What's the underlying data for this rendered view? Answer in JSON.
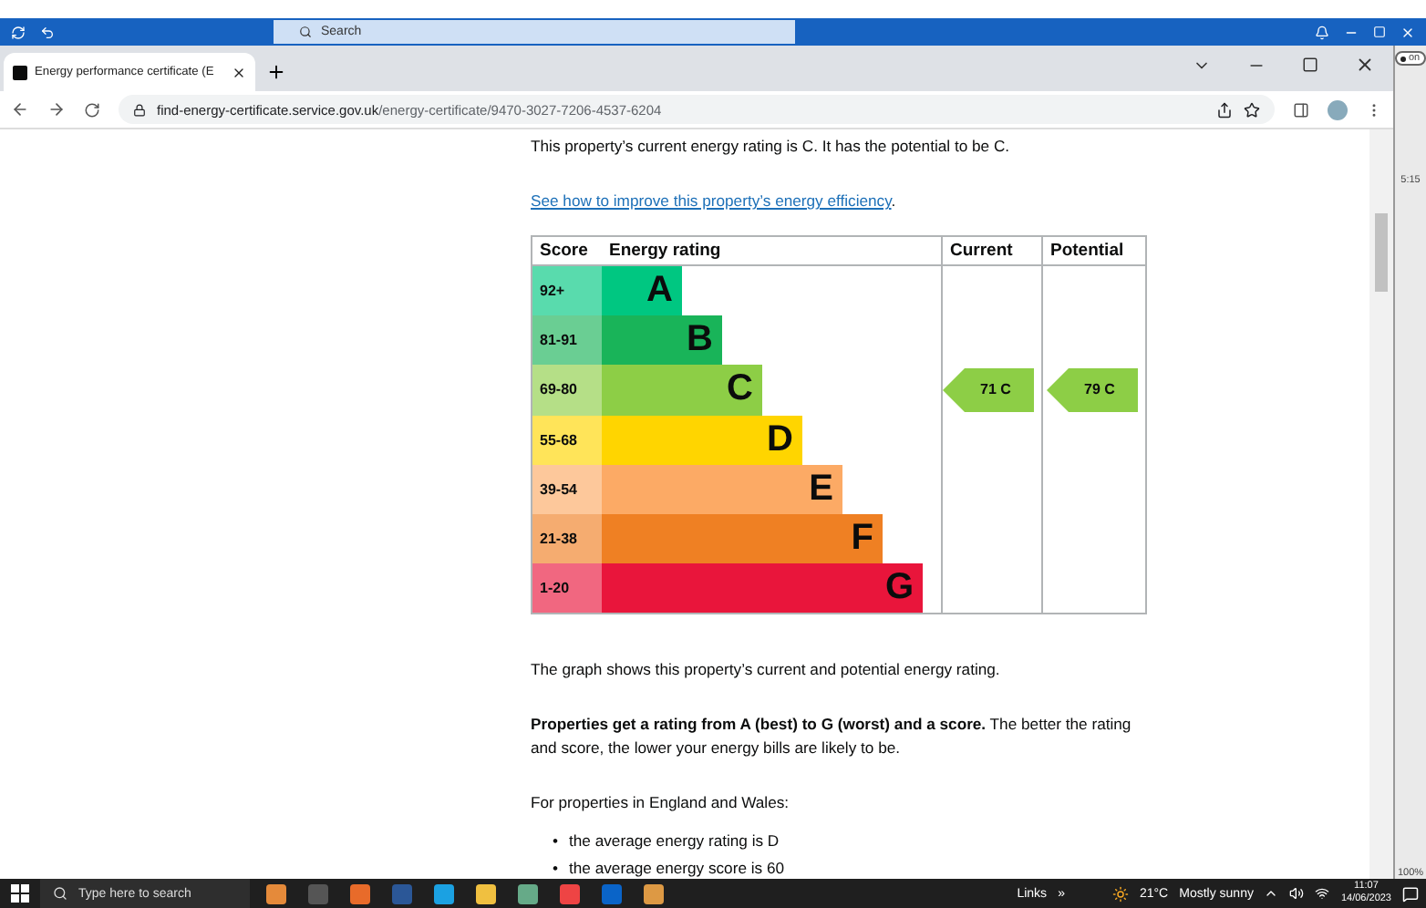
{
  "os_bar": {
    "search_placeholder": "Search"
  },
  "browser": {
    "tab": {
      "title": "Energy performance certificate (E",
      "selected": true
    },
    "url_host": "find-energy-certificate.service.gov.uk",
    "url_path": "/energy-certificate/9470-3027-7206-4537-6204"
  },
  "page": {
    "intro": "This property’s current energy rating is C. It has the potential to be C.",
    "link": "See how to improve this property’s energy efficiency",
    "link_suffix": ".",
    "chart": {
      "columns": [
        "Score",
        "Energy rating",
        "Current",
        "Potential"
      ],
      "rows": [
        {
          "score": "92+",
          "rating": "A",
          "color": "#00c781"
        },
        {
          "score": "81-91",
          "rating": "B",
          "color": "#19b459"
        },
        {
          "score": "69-80",
          "rating": "C",
          "color": "#8dce46",
          "current": "71 C",
          "potential": "79 C"
        },
        {
          "score": "55-68",
          "rating": "D",
          "color": "#ffd500"
        },
        {
          "score": "39-54",
          "rating": "E",
          "color": "#fcaa65"
        },
        {
          "score": "21-38",
          "rating": "F",
          "color": "#ef8023"
        },
        {
          "score": "1-20",
          "rating": "G",
          "color": "#e9153b"
        }
      ]
    },
    "graph_note": "The graph shows this property’s current and potential energy rating.",
    "rating_note": "**Properties get a rating from A (best) to G (worst) and a score.** The better the rating and score, the lower your energy bills are likely to be.",
    "regions_note": "For properties in England and Wales:",
    "bullets": [
      {
        "marker": "•",
        "text": "the average energy rating is D"
      },
      {
        "marker": "•",
        "text": "the average energy score is 60"
      }
    ]
  },
  "side": {
    "toggle": "on",
    "toggle_on": true,
    "time": "5:15",
    "zoom": "100%"
  },
  "taskbar": {
    "search_placeholder": "Type here to search",
    "links": "Links",
    "more": "»",
    "temperature": "21°C",
    "weather": "Mostly sunny",
    "time": "11:07",
    "date": "14/06/2023"
  }
}
